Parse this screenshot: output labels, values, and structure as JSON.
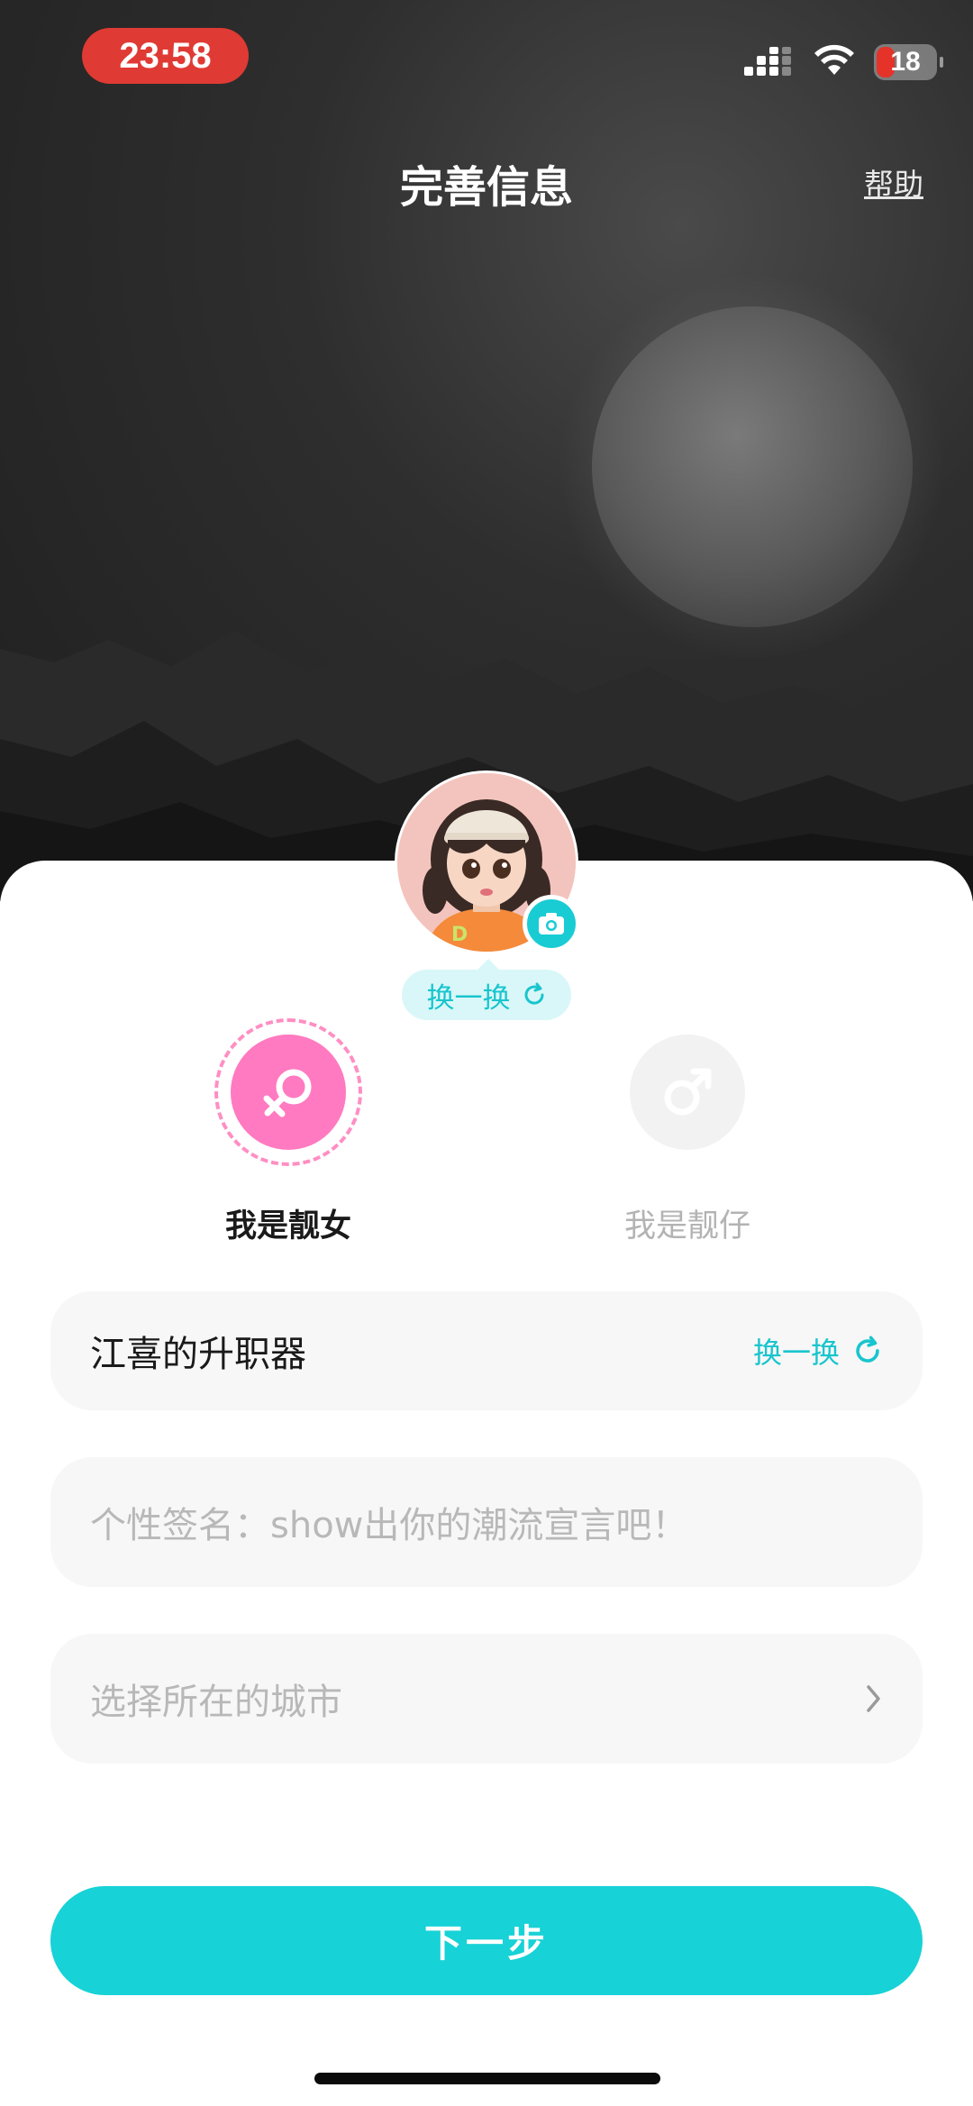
{
  "status": {
    "time": "23:58",
    "battery": "18"
  },
  "header": {
    "title": "完善信息",
    "help": "帮助"
  },
  "avatar": {
    "swap_label": "换一换"
  },
  "gender": {
    "female_label": "我是靓女",
    "male_label": "我是靓仔",
    "selected": "female"
  },
  "nickname": {
    "value": "江喜的升职器",
    "swap_label": "换一换"
  },
  "signature": {
    "placeholder": "个性签名：show出你的潮流宣言吧！"
  },
  "city": {
    "placeholder": "选择所在的城市"
  },
  "next_button": "下一步",
  "colors": {
    "accent": "#17d2d6",
    "female": "#ff7ac0",
    "status_time_bg": "#e03a34"
  },
  "icons": [
    "camera-icon",
    "refresh-icon",
    "female-icon",
    "male-icon",
    "chevron-right-icon",
    "wifi-icon",
    "signal-icon",
    "battery-icon"
  ]
}
